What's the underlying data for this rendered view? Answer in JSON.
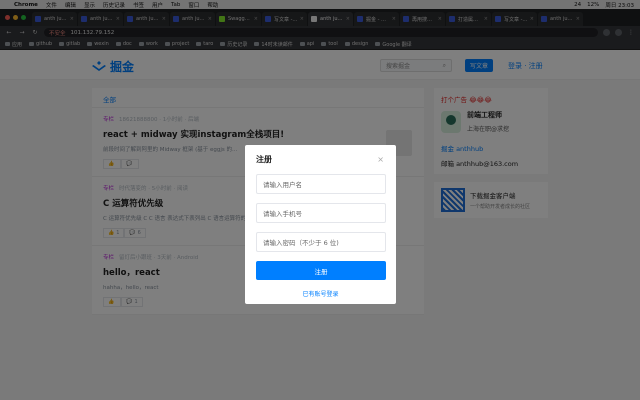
{
  "menubar": {
    "items": [
      "Chrome",
      "文件",
      "编辑",
      "显示",
      "历史记录",
      "书签",
      "用户",
      "Tab",
      "窗口",
      "帮助"
    ],
    "status_right": [
      "24",
      "12%",
      "周日 23:03"
    ]
  },
  "tabs": [
    {
      "label": "anth juejin",
      "color": "#3b5bdb"
    },
    {
      "label": "anth juejin",
      "color": "#3b5bdb"
    },
    {
      "label": "anth juejin",
      "color": "#3b5bdb"
    },
    {
      "label": "anth juejin",
      "color": "#3b5bdb"
    },
    {
      "label": "Swagger UI",
      "color": "#85ea2d"
    },
    {
      "label": "写文章 - 什...",
      "color": "#3b5bdb"
    },
    {
      "label": "anth juejin",
      "color": "#eeeeee"
    },
    {
      "label": "掘金 - 搜索",
      "color": "#3b5bdb"
    },
    {
      "label": "再用搜一个印...",
      "color": "#3b5bdb"
    },
    {
      "label": "打造属于你...",
      "color": "#3b5bdb"
    },
    {
      "label": "写文章 - rea...",
      "color": "#3b5bdb"
    },
    {
      "label": "anth juejin",
      "color": "#3b5bdb"
    }
  ],
  "address": {
    "insecure_label": "不安全",
    "url": "101.132.79.152"
  },
  "bookmarks": [
    "应用",
    "github",
    "gitlab",
    "wexin",
    "doc",
    "work",
    "project",
    "taro",
    "历史记录",
    "14时未读邮件",
    "api",
    "tool",
    "design",
    "Google 翻译"
  ],
  "site": {
    "logo_text": "掘金",
    "search_placeholder": "搜索掘金",
    "write_button": "写文章",
    "login_links": "登录 · 注册"
  },
  "feed": {
    "filter": "全部",
    "articles": [
      {
        "tag": "专栏",
        "meta": "18621888800 · 1小时前 · 后端",
        "title": "react + midway 实现instagram全栈项目!",
        "summary": "前段时间了解到阿里的 Midway 框架 (基于 eggjs 的...",
        "likes": "",
        "comments": ""
      },
      {
        "tag": "专栏",
        "meta": "时代落变的 · 5小时前 · 阅读",
        "title": "C 运算符优先级",
        "summary": "C 运算符优先级 C C 语言 表达式下表列出 C 语言运算符的优先级",
        "likes": "1",
        "comments": "6"
      },
      {
        "tag": "专栏",
        "meta": "留灯后小跟班 · 3天前 · Android",
        "title": "hello，react",
        "summary": "hahha，hello，react",
        "likes": "",
        "comments": "1"
      }
    ]
  },
  "sidebar": {
    "ad_title": "打个广告 😂😂😂",
    "role": "前端工程师",
    "location": "上海在职@求挖",
    "juejin": "掘金  anthhub",
    "email": "邮箱  anthhub@163.com",
    "download_title": "下载掘金客户端",
    "download_sub": "一个帮助开发者成长的社区"
  },
  "modal": {
    "title": "注册",
    "close": "×",
    "username_placeholder": "请输入用户名",
    "phone_placeholder": "请输入手机号",
    "password_placeholder": "请输入密码（不少于 6 位)",
    "submit_label": "注册",
    "switch_label": "已有账号登录"
  }
}
